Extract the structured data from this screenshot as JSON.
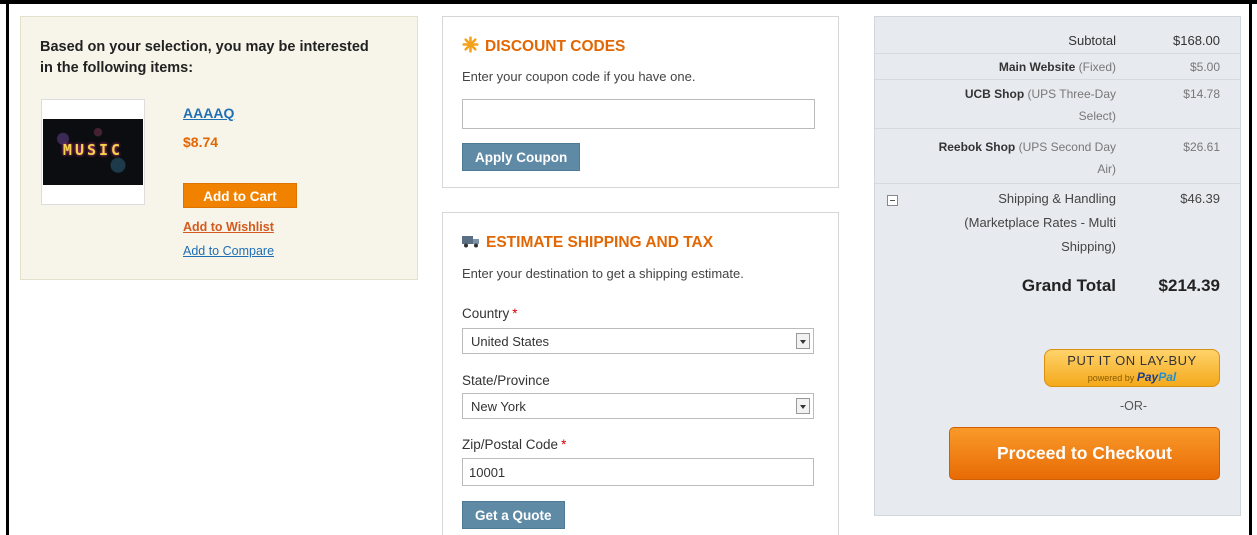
{
  "crosssell": {
    "heading": "Based on your selection, you may be interested in the following items:",
    "product": {
      "image_text": "MUSIC",
      "name": "AAAAQ",
      "price": "$8.74",
      "add_to_cart": "Add to Cart",
      "add_to_wishlist": "Add to Wishlist",
      "add_to_compare": "Add to Compare"
    }
  },
  "discount": {
    "title": "DISCOUNT CODES",
    "intro": "Enter your coupon code if you have one.",
    "coupon_value": "",
    "apply_label": "Apply Coupon"
  },
  "shipping": {
    "title": "ESTIMATE SHIPPING AND TAX",
    "intro": "Enter your destination to get a shipping estimate.",
    "country_label": "Country",
    "country_value": "United States",
    "state_label": "State/Province",
    "state_value": "New York",
    "zip_label": "Zip/Postal Code",
    "zip_value": "10001",
    "required_mark": "*",
    "quote_label": "Get a Quote"
  },
  "totals": {
    "subtotal_label": "Subtotal",
    "subtotal_value": "$168.00",
    "main_site_name": "Main Website",
    "main_site_note": "(Fixed)",
    "main_site_value": "$5.00",
    "ucb_name": "UCB Shop",
    "ucb_note_1": "(UPS Three-Day",
    "ucb_note_2": "Select)",
    "ucb_value": "$14.78",
    "reebok_name": "Reebok Shop",
    "reebok_note_1": "(UPS Second Day",
    "reebok_note_2": "Air)",
    "reebok_value": "$26.61",
    "shipping_line_1": "Shipping & Handling",
    "shipping_line_2": "(Marketplace Rates - Multi",
    "shipping_line_3": "Shipping)",
    "shipping_value": "$46.39",
    "grand_total_label": "Grand Total",
    "grand_total_value": "$214.39",
    "laybuy_line_1": "PUT IT ON LAY-BUY",
    "laybuy_line_2": "powered by",
    "laybuy_brand_1": "Pay",
    "laybuy_brand_2": "Pal",
    "or_label": "-OR-",
    "checkout_label": "Proceed to Checkout"
  },
  "colors": {
    "accent_orange": "#e26703",
    "link_blue": "#1f6fb5",
    "button_grey_blue": "#5f8aa6",
    "totals_bg": "#e7ebef"
  }
}
